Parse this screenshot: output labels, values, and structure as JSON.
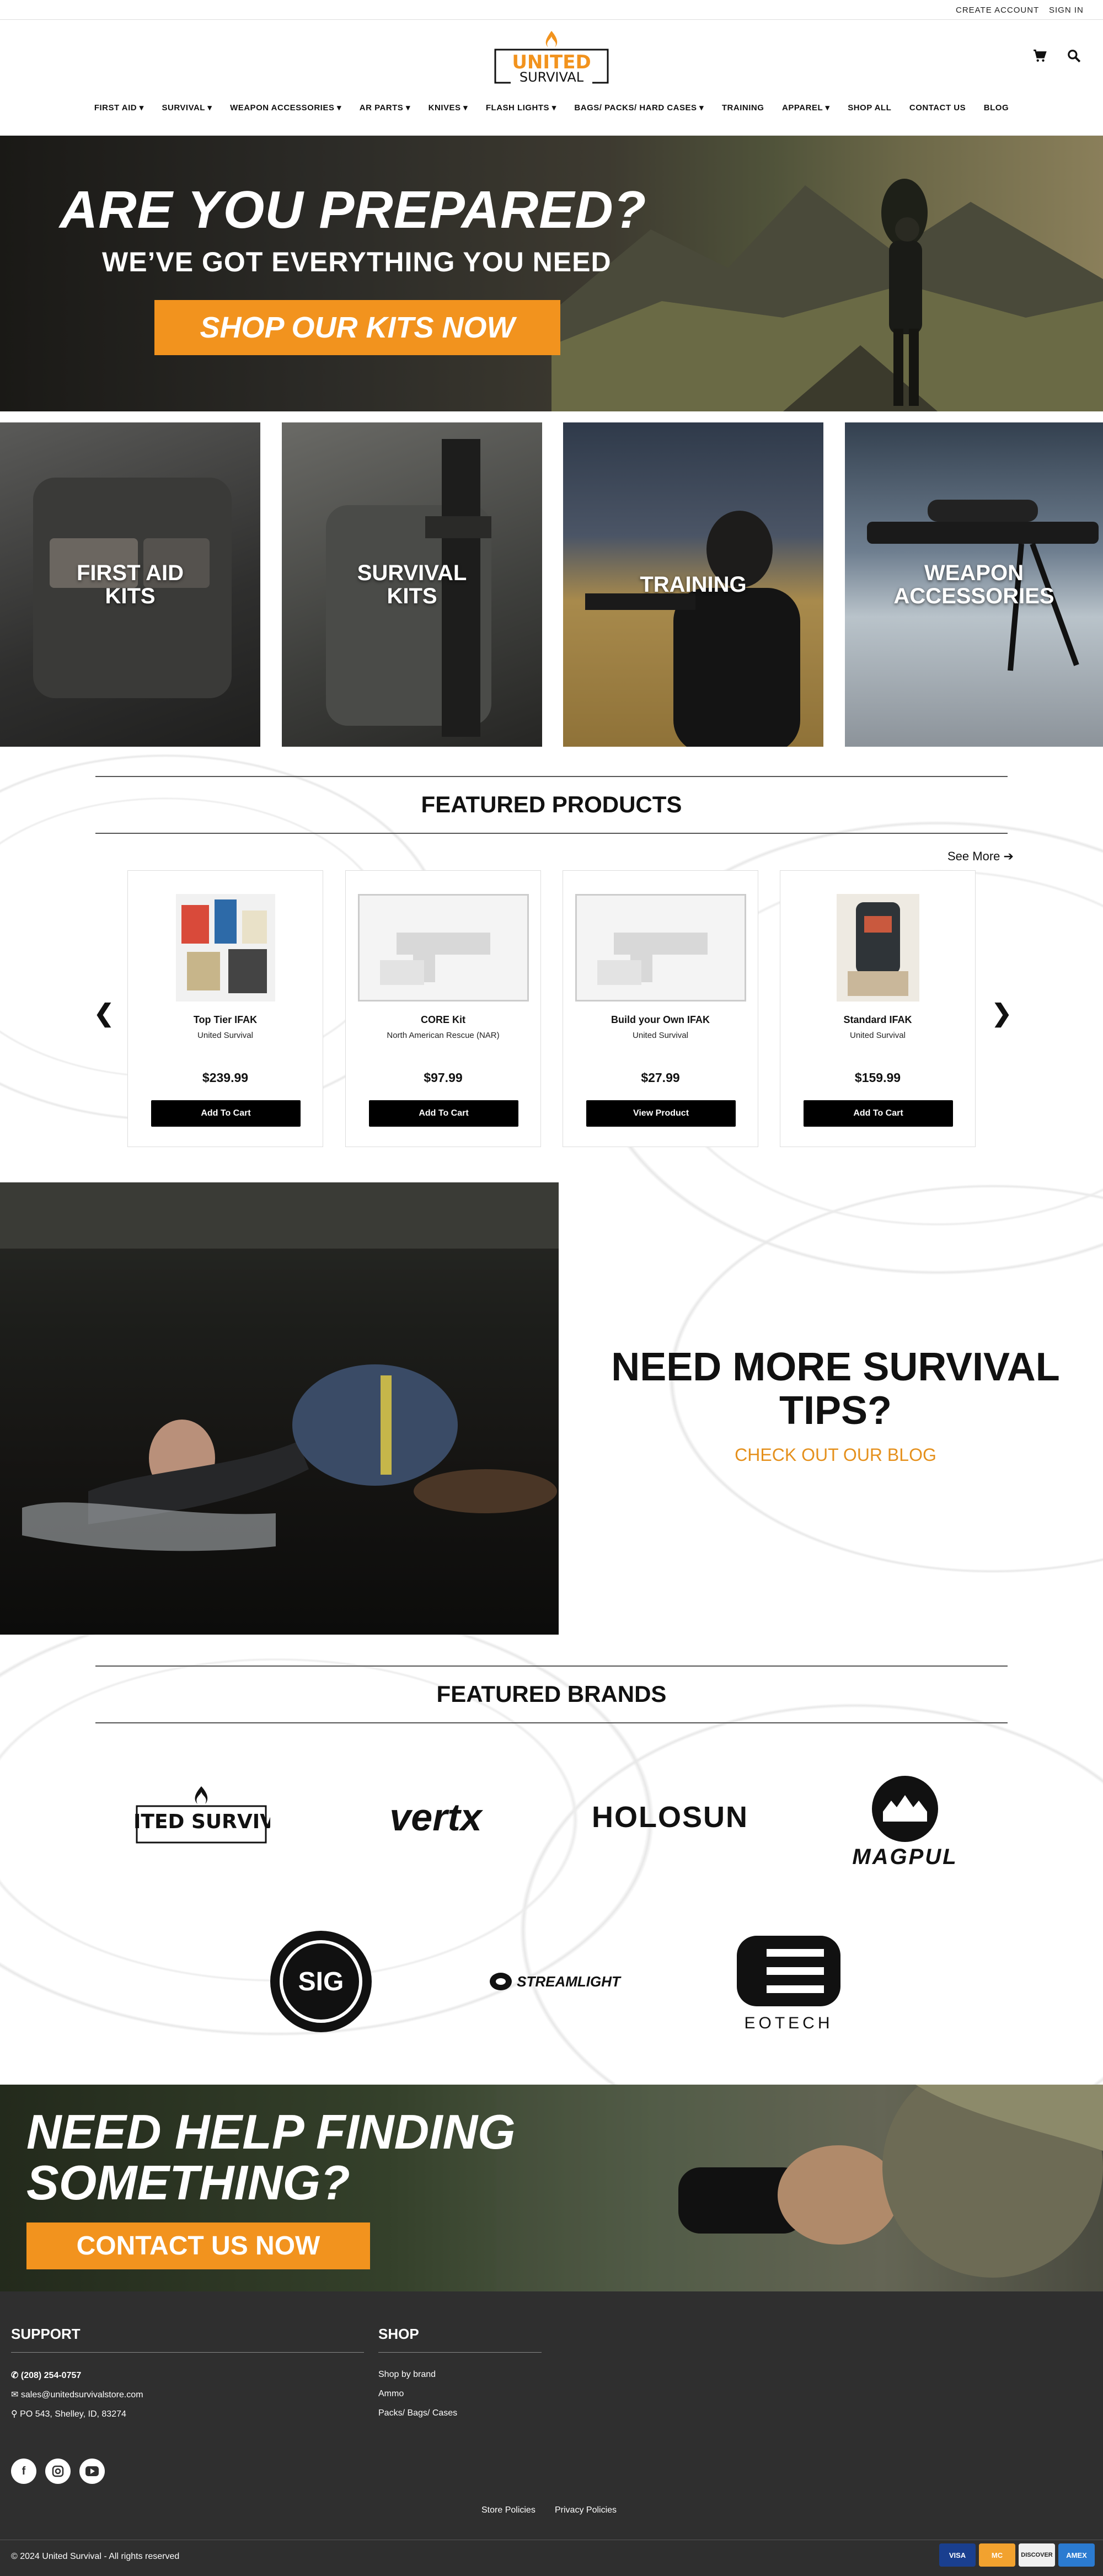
{
  "utility": {
    "create_account": "CREATE ACCOUNT",
    "sign_in": "SIGN IN"
  },
  "logo": {
    "line1": "UNITED",
    "line2": "SURVIVAL"
  },
  "header_icons": [
    "cart-icon",
    "search-icon"
  ],
  "nav": [
    "FIRST AID ▾",
    "SURVIVAL ▾",
    "WEAPON ACCESSORIES ▾",
    "AR PARTS ▾",
    "KNIVES ▾",
    "FLASH LIGHTS ▾",
    "BAGS/ PACKS/ HARD CASES ▾",
    "TRAINING",
    "APPAREL ▾",
    "SHOP ALL",
    "CONTACT US",
    "BLOG"
  ],
  "hero": {
    "headline": "ARE YOU PREPARED?",
    "subhead": "WE’VE GOT EVERYTHING YOU NEED",
    "cta": "SHOP OUR KITS NOW"
  },
  "categories": [
    "FIRST AID\nKITS",
    "SURVIVAL\nKITS",
    "TRAINING",
    "WEAPON\nACCESSORIES"
  ],
  "featured_products": {
    "title": "FEATURED PRODUCTS",
    "see_more": "See More",
    "items": [
      {
        "name": "Top Tier IFAK",
        "brand": "United Survival",
        "price": "$239.99",
        "button": "Add To Cart"
      },
      {
        "name": "CORE Kit",
        "brand": "North American Rescue (NAR)",
        "price": "$97.99",
        "button": "Add To Cart"
      },
      {
        "name": "Build your Own IFAK",
        "brand": "United Survival",
        "price": "$27.99",
        "button": "View Product"
      },
      {
        "name": "Standard IFAK",
        "brand": "United Survival",
        "price": "$159.99",
        "button": "Add To Cart"
      }
    ]
  },
  "blog": {
    "title": "NEED MORE SURVIVAL TIPS?",
    "link": "CHECK OUT OUR BLOG"
  },
  "featured_brands": {
    "title": "FEATURED BRANDS",
    "items": [
      "UNITED SURVIVAL",
      "vertx",
      "HOLOSUN",
      "MAGPUL",
      "SIG",
      "STREAMLIGHT",
      "EOTECH"
    ]
  },
  "cta": {
    "line1": "NEED HELP FINDING",
    "line2": "SOMETHING?",
    "button": "CONTACT US NOW"
  },
  "footer": {
    "support_title": "SUPPORT",
    "phone": "(208) 254-0757",
    "email": "sales@unitedsurvivalstore.com",
    "address": "PO 543, Shelley, ID, 83274",
    "shop_title": "SHOP",
    "shop_links": [
      "Shop by brand",
      "Ammo",
      "Packs/ Bags/ Cases"
    ],
    "policies": [
      "Store Policies",
      "Privacy Policies"
    ],
    "copyright": "© 2024 United Survival - All rights reserved",
    "payments": [
      "VISA",
      "MC",
      "DISCOVER",
      "AMEX"
    ]
  },
  "colors": {
    "accent": "#f2931e",
    "footer_bg": "#2f2f2f"
  }
}
